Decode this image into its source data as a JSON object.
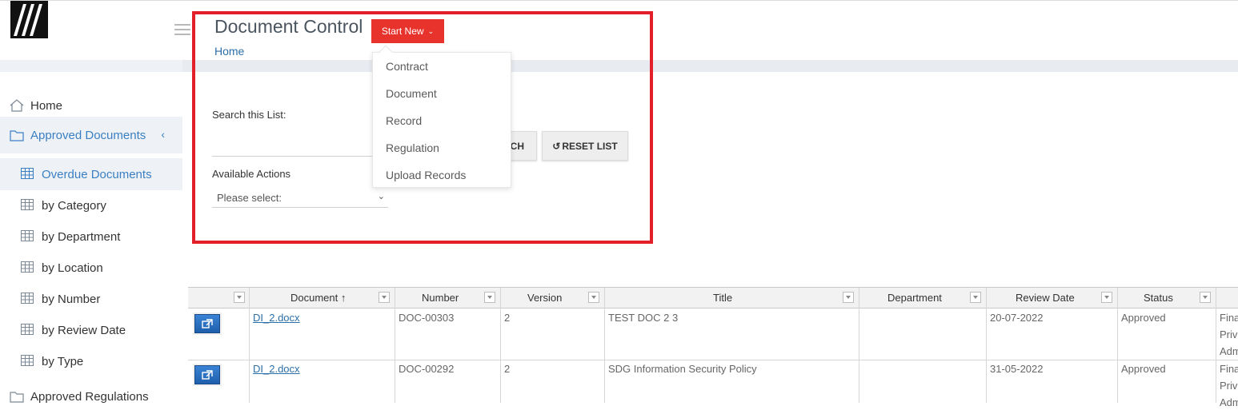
{
  "app": {
    "title": "Document Control",
    "start_new_label": "Start New",
    "breadcrumb": "Home"
  },
  "sidebar": {
    "home": "Home",
    "approved_documents": "Approved Documents",
    "items": [
      {
        "label": "Overdue Documents"
      },
      {
        "label": "by Category"
      },
      {
        "label": "by Department"
      },
      {
        "label": "by Location"
      },
      {
        "label": "by Number"
      },
      {
        "label": "by Review Date"
      },
      {
        "label": "by Type"
      }
    ],
    "approved_regulations": "Approved Regulations"
  },
  "search": {
    "label": "Search this List:",
    "value": "",
    "search_button_visible_text": "CH",
    "reset_button": "RESET LIST"
  },
  "actions": {
    "label": "Available Actions",
    "selected": "Please select:"
  },
  "start_new_menu": [
    "Contract",
    "Document",
    "Record",
    "Regulation",
    "Upload Records"
  ],
  "table": {
    "headers": [
      "Document",
      "Number",
      "Version",
      "Title",
      "Department",
      "Review Date",
      "Status"
    ],
    "sort_indicator": "↑",
    "rows": [
      {
        "document": "DI_2.docx",
        "number": "DOC-00303",
        "version": "2",
        "title": "TEST DOC 2 3",
        "department": "",
        "review_date": "20-07-2022",
        "status": "Approved",
        "extra": [
          "Fina",
          "Priva",
          "Adm"
        ]
      },
      {
        "document": "DI_2.docx",
        "number": "DOC-00292",
        "version": "2",
        "title": "SDG Information Security Policy",
        "department": "",
        "review_date": "31-05-2022",
        "status": "Approved",
        "extra": [
          "Fina",
          "Priva",
          "Adm"
        ]
      }
    ]
  },
  "colors": {
    "accent_red": "#e8322c",
    "highlight_red": "#e3202a",
    "link_blue": "#2a6fa8",
    "sidebar_active_bg": "#eef2f7"
  }
}
